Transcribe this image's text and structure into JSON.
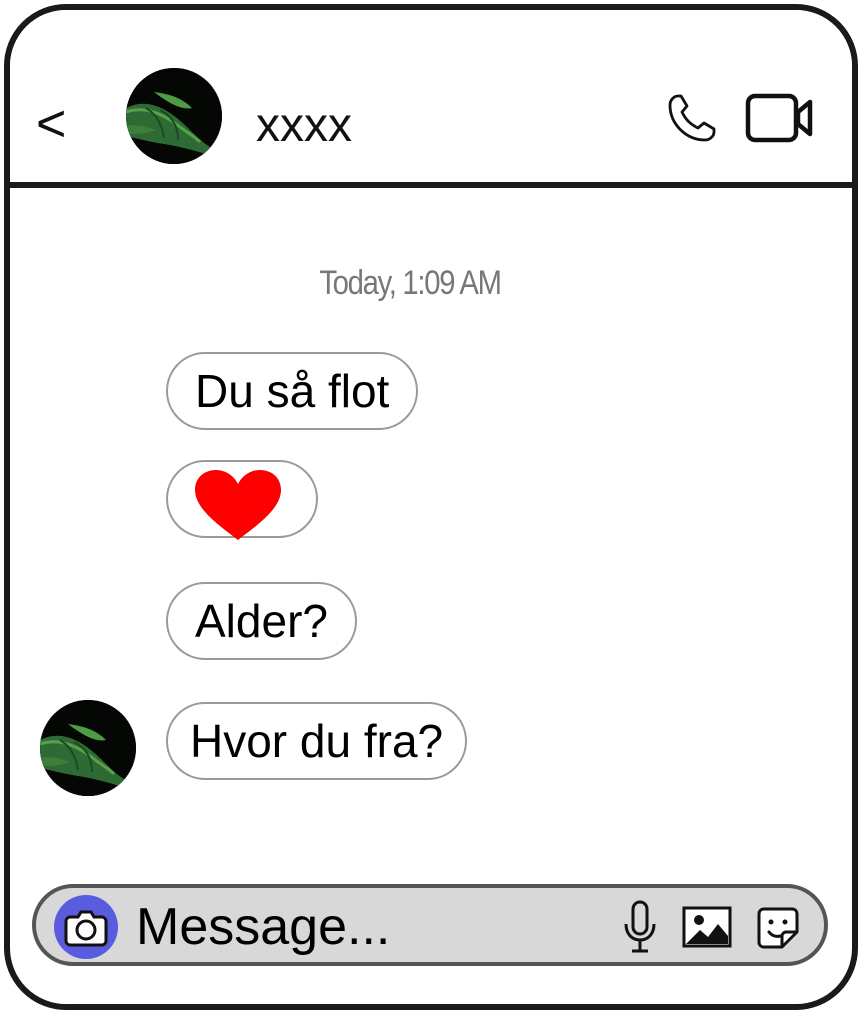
{
  "header": {
    "back_label": "<",
    "contact_name": "xxxx",
    "icons": {
      "back": "back-chevron-icon",
      "call": "phone-icon",
      "video": "video-camera-icon"
    }
  },
  "chat": {
    "timestamp": "Today, 1:09 AM",
    "messages": [
      {
        "type": "text",
        "text": "Du så flot"
      },
      {
        "type": "emoji",
        "icon": "red-heart-icon",
        "color": "#ff0000"
      },
      {
        "type": "text",
        "text": "Alder?"
      },
      {
        "type": "text",
        "text": "Hvor du fra?",
        "show_avatar": true
      }
    ]
  },
  "composer": {
    "placeholder": "Message...",
    "camera_button_color": "#5a5ce0",
    "icons": [
      "camera-icon",
      "microphone-icon",
      "gallery-icon",
      "sticker-icon"
    ]
  },
  "colors": {
    "frame": "#1a1a1a",
    "bubble_border": "#9a9a9a",
    "composer_bg": "#d8d8d8",
    "timestamp": "#777777"
  }
}
